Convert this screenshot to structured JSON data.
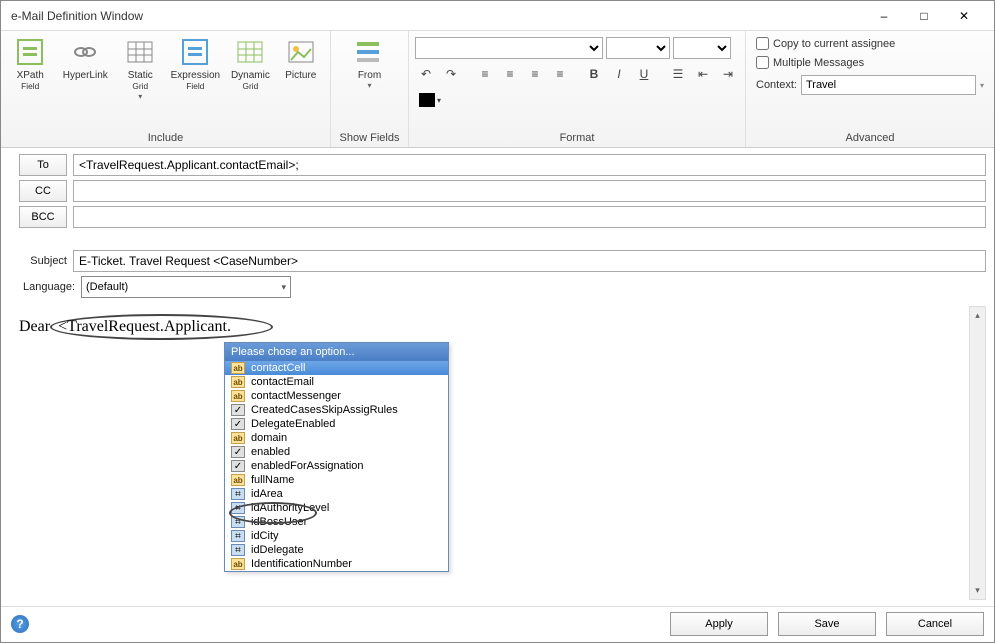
{
  "window": {
    "title": "e-Mail Definition Window"
  },
  "ribbon": {
    "include": {
      "label": "Include",
      "items": [
        {
          "label1": "XPath",
          "label2": "Field",
          "icon": "xpath"
        },
        {
          "label1": "HyperLink",
          "label2": "",
          "icon": "link"
        },
        {
          "label1": "Static",
          "label2": "Grid",
          "icon": "sgrid",
          "dd": true
        },
        {
          "label1": "Expression",
          "label2": "Field",
          "icon": "expr"
        },
        {
          "label1": "Dynamic",
          "label2": "Grid",
          "icon": "dgrid"
        },
        {
          "label1": "Picture",
          "label2": "",
          "icon": "pic"
        }
      ]
    },
    "showfields": {
      "label": "Show Fields",
      "from": "From"
    },
    "format": {
      "label": "Format"
    },
    "advanced": {
      "label": "Advanced",
      "copy": "Copy to current assignee",
      "multi": "Multiple Messages",
      "ctxLabel": "Context:",
      "ctxValue": "Travel"
    }
  },
  "fields": {
    "to": {
      "label": "To",
      "value": "<TravelRequest.Applicant.contactEmail>;"
    },
    "cc": {
      "label": "CC",
      "value": ""
    },
    "bcc": {
      "label": "BCC",
      "value": ""
    },
    "subject": {
      "label": "Subject",
      "value": "E-Ticket. Travel Request <CaseNumber>"
    },
    "language": {
      "label": "Language:",
      "value": "(Default)"
    }
  },
  "editor": {
    "prefix": "Dear",
    "xpath": "<TravelRequest.Applicant."
  },
  "autocomplete": {
    "header": "Please chose an option...",
    "items": [
      {
        "label": "contactCell",
        "type": "txt",
        "selected": true
      },
      {
        "label": "contactEmail",
        "type": "txt"
      },
      {
        "label": "contactMessenger",
        "type": "txt"
      },
      {
        "label": "CreatedCasesSkipAssigRules",
        "type": "bool"
      },
      {
        "label": "DelegateEnabled",
        "type": "bool"
      },
      {
        "label": "domain",
        "type": "txt"
      },
      {
        "label": "enabled",
        "type": "bool"
      },
      {
        "label": "enabledForAssignation",
        "type": "bool"
      },
      {
        "label": "fullName",
        "type": "txt",
        "circled": true
      },
      {
        "label": "idArea",
        "type": "ent"
      },
      {
        "label": "idAuthorityLevel",
        "type": "ent"
      },
      {
        "label": "idBossUser",
        "type": "ent"
      },
      {
        "label": "idCity",
        "type": "ent"
      },
      {
        "label": "idDelegate",
        "type": "ent"
      },
      {
        "label": "IdentificationNumber",
        "type": "txt"
      }
    ]
  },
  "buttons": {
    "apply": "Apply",
    "save": "Save",
    "cancel": "Cancel"
  }
}
